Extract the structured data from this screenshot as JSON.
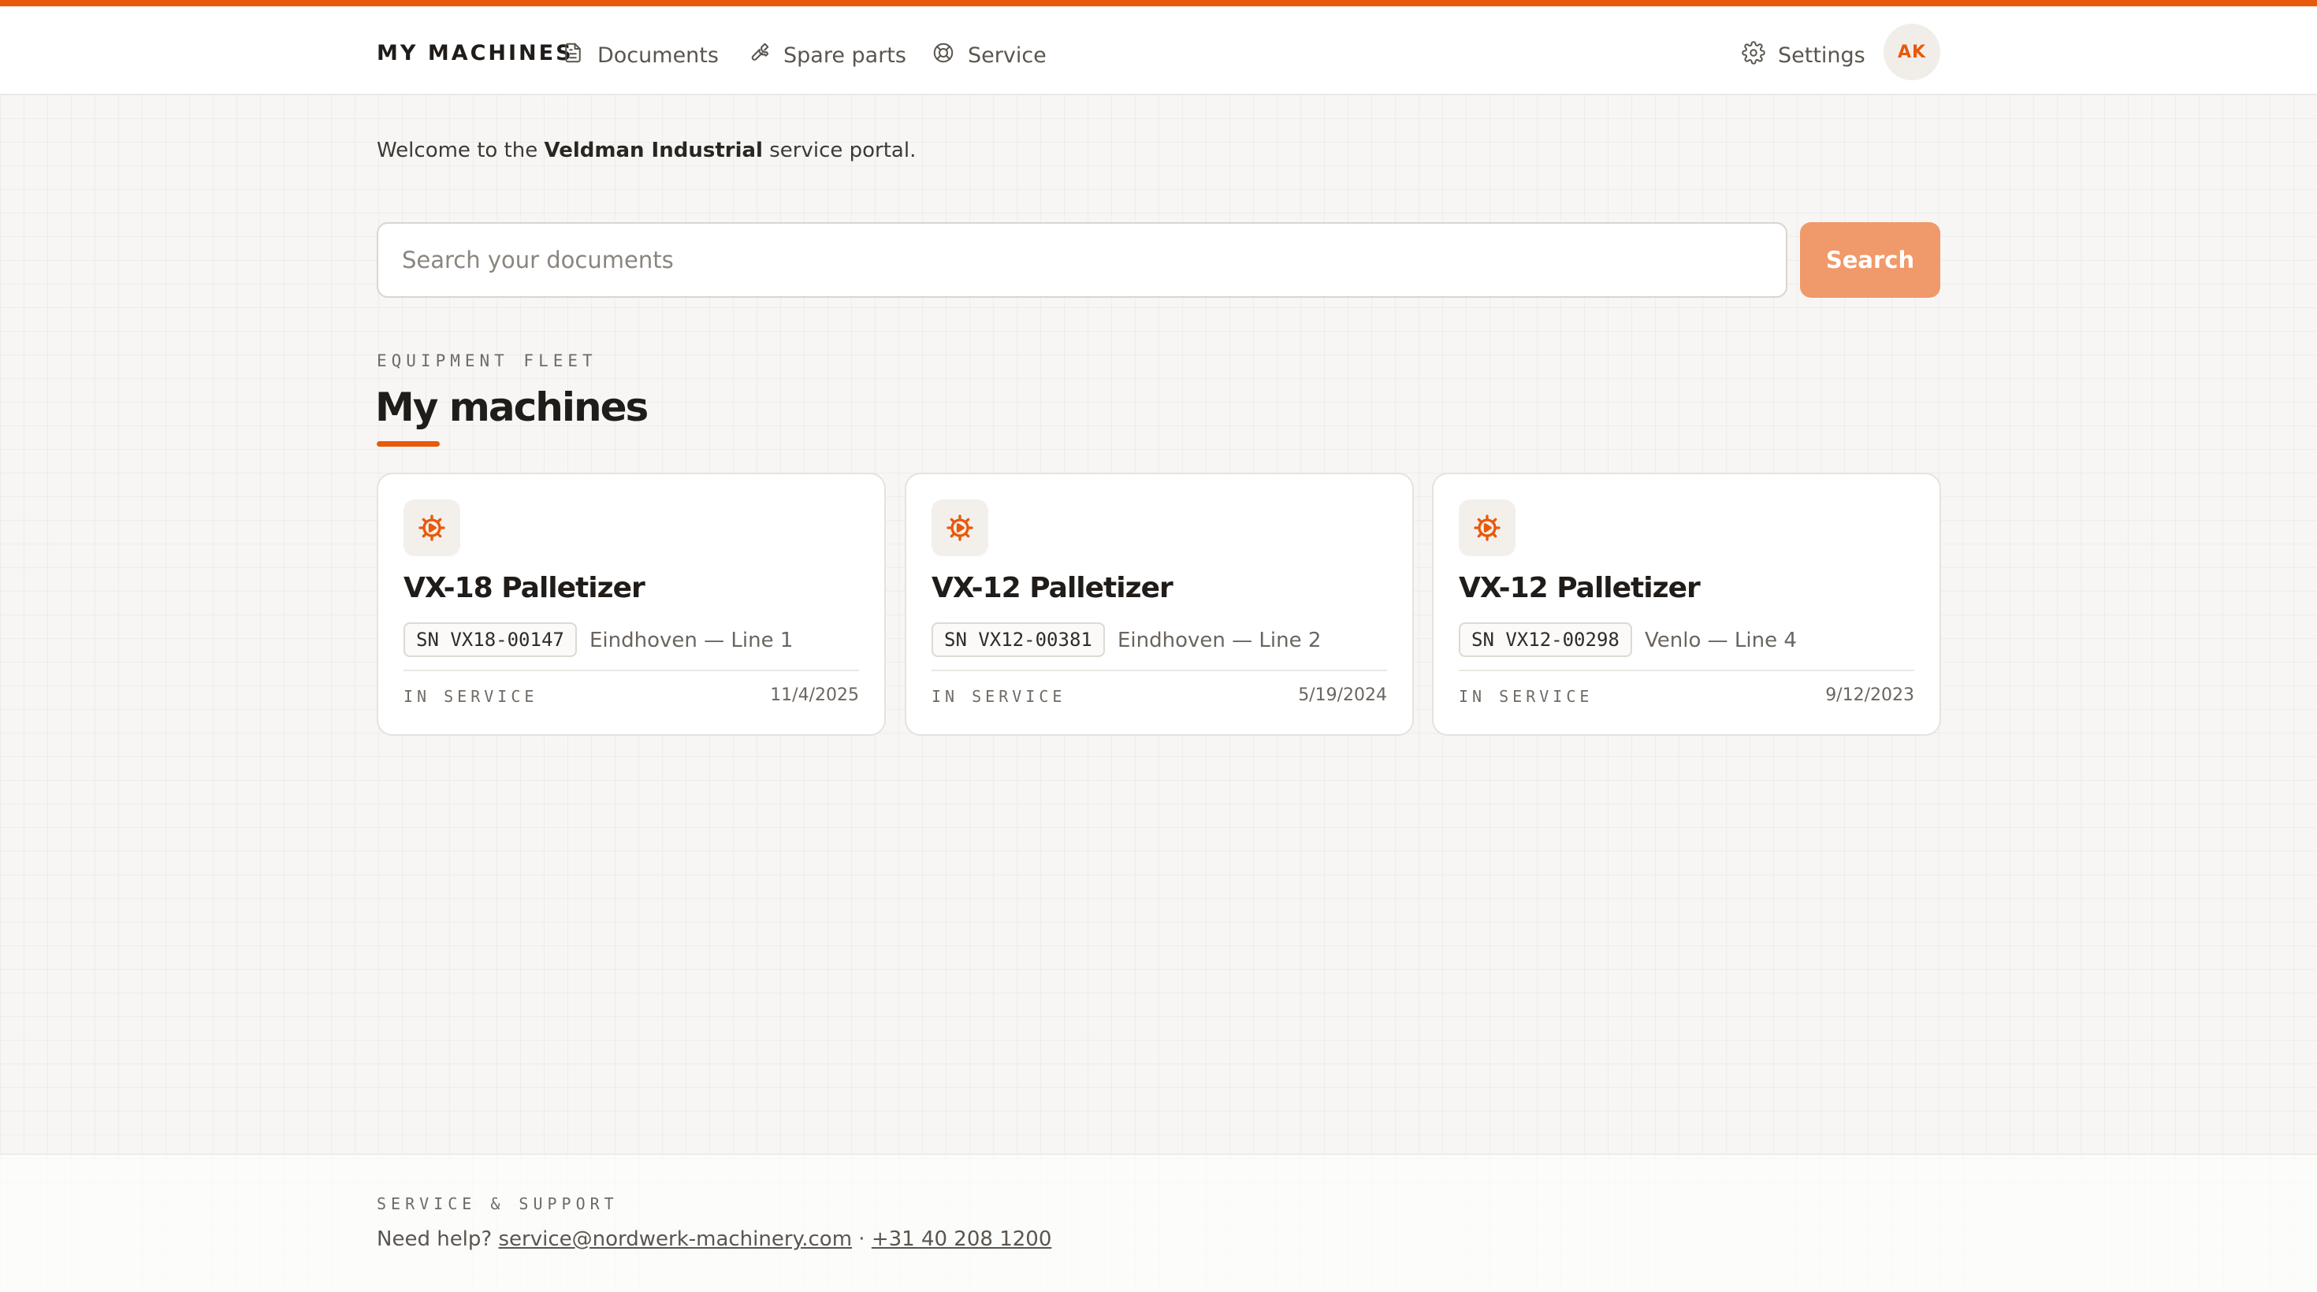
{
  "header": {
    "brand": "MY MACHINES",
    "nav": [
      {
        "label": "Documents",
        "icon": "document-icon"
      },
      {
        "label": "Spare parts",
        "icon": "wrench-icon"
      },
      {
        "label": "Service",
        "icon": "lifebuoy-icon"
      }
    ],
    "settings_label": "Settings",
    "avatar_initials": "AK"
  },
  "welcome": {
    "prefix": "Welcome to the ",
    "company": "Veldman Industrial",
    "suffix": " service portal."
  },
  "search": {
    "placeholder": "Search your documents",
    "value": "",
    "button_label": "Search"
  },
  "section": {
    "eyebrow": "EQUIPMENT FLEET",
    "title": "My machines"
  },
  "machines": [
    {
      "name": "VX-18 Palletizer",
      "serial": "SN VX18-00147",
      "location": "Eindhoven — Line 1",
      "status": "IN SERVICE",
      "date": "11/4/2025",
      "icon": "gear-icon"
    },
    {
      "name": "VX-12 Palletizer",
      "serial": "SN VX12-00381",
      "location": "Eindhoven — Line 2",
      "status": "IN SERVICE",
      "date": "5/19/2024",
      "icon": "gear-icon"
    },
    {
      "name": "VX-12 Palletizer",
      "serial": "SN VX12-00298",
      "location": "Venlo — Line 4",
      "status": "IN SERVICE",
      "date": "9/12/2023",
      "icon": "gear-icon"
    }
  ],
  "footer": {
    "eyebrow": "SERVICE & SUPPORT",
    "help_text": "Need help? ",
    "email": "service@nordwerk-machinery.com",
    "separator": " · ",
    "phone": "+31 40 208 1200"
  },
  "colors": {
    "accent": "#e8590c",
    "search_button": "#f0996a",
    "background": "#f7f6f4"
  }
}
